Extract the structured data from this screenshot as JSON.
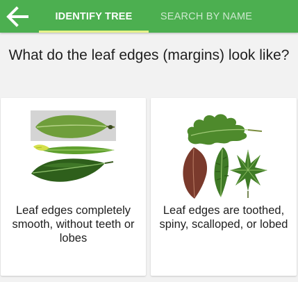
{
  "appbar": {
    "background": "#4caf50",
    "back_icon": "arrow-left-icon",
    "tabs": [
      {
        "label": "IDENTIFY TREE",
        "selected": true
      },
      {
        "label": "SEARCH BY NAME",
        "selected": false
      }
    ],
    "indicator_color": "#e6f28a"
  },
  "question": "What do the leaf edges (margins) look like?",
  "options": [
    {
      "label": "Leaf edges completely smooth, without teeth or lobes",
      "image": "smooth-leaves-image"
    },
    {
      "label": "Leaf edges are toothed, spiny, scalloped, or lobed",
      "image": "toothed-lobed-leaves-image"
    }
  ]
}
